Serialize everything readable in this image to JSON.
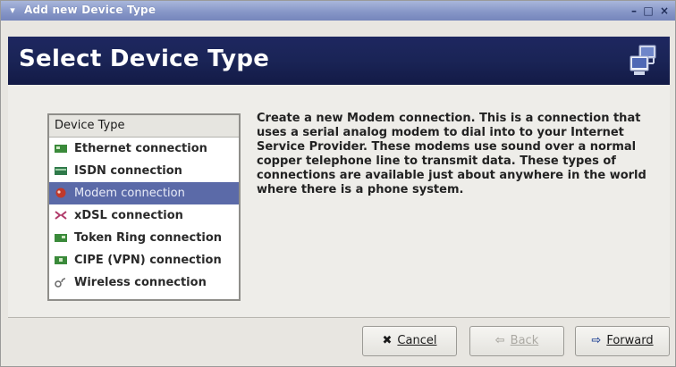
{
  "window": {
    "title": "Add new Device Type",
    "menu_glyph": "▾",
    "minimize_glyph": "–",
    "maximize_glyph": "□",
    "close_glyph": "×"
  },
  "header": {
    "title": "Select Device Type",
    "icon": "network-computer-icon"
  },
  "device_list": {
    "column_header": "Device Type",
    "items": [
      {
        "label": "Ethernet connection",
        "icon": "ethernet-card-icon",
        "icon_color": "#3a8a3a",
        "selected": false
      },
      {
        "label": "ISDN connection",
        "icon": "isdn-card-icon",
        "icon_color": "#2f7a4a",
        "selected": false
      },
      {
        "label": "Modem connection",
        "icon": "modem-icon",
        "icon_color": "#c0392b",
        "selected": true
      },
      {
        "label": "xDSL connection",
        "icon": "xdsl-icon",
        "icon_color": "#b03a6a",
        "selected": false
      },
      {
        "label": "Token Ring connection",
        "icon": "token-ring-icon",
        "icon_color": "#3a8a3a",
        "selected": false
      },
      {
        "label": "CIPE (VPN) connection",
        "icon": "vpn-icon",
        "icon_color": "#3a8a3a",
        "selected": false
      },
      {
        "label": "Wireless connection",
        "icon": "wireless-icon",
        "icon_color": "#666666",
        "selected": false
      }
    ]
  },
  "description": "Create a new Modem connection.  This is a connection that uses a serial analog modem to dial into to your Internet Service Provider. These modems use sound over a normal copper telephone line to transmit data.  These types of connections are available just about anywhere in the world where there is a phone system.",
  "buttons": {
    "cancel": {
      "label": "Cancel",
      "icon": "✖",
      "enabled": true
    },
    "back": {
      "label": "Back",
      "icon": "⇦",
      "enabled": false
    },
    "forward": {
      "label": "Forward",
      "icon": "⇨",
      "enabled": true
    }
  },
  "colors": {
    "header_bg": "#1a2456",
    "selection_bg": "#5b6aa8",
    "titlebar_bg": "#8797c8"
  }
}
